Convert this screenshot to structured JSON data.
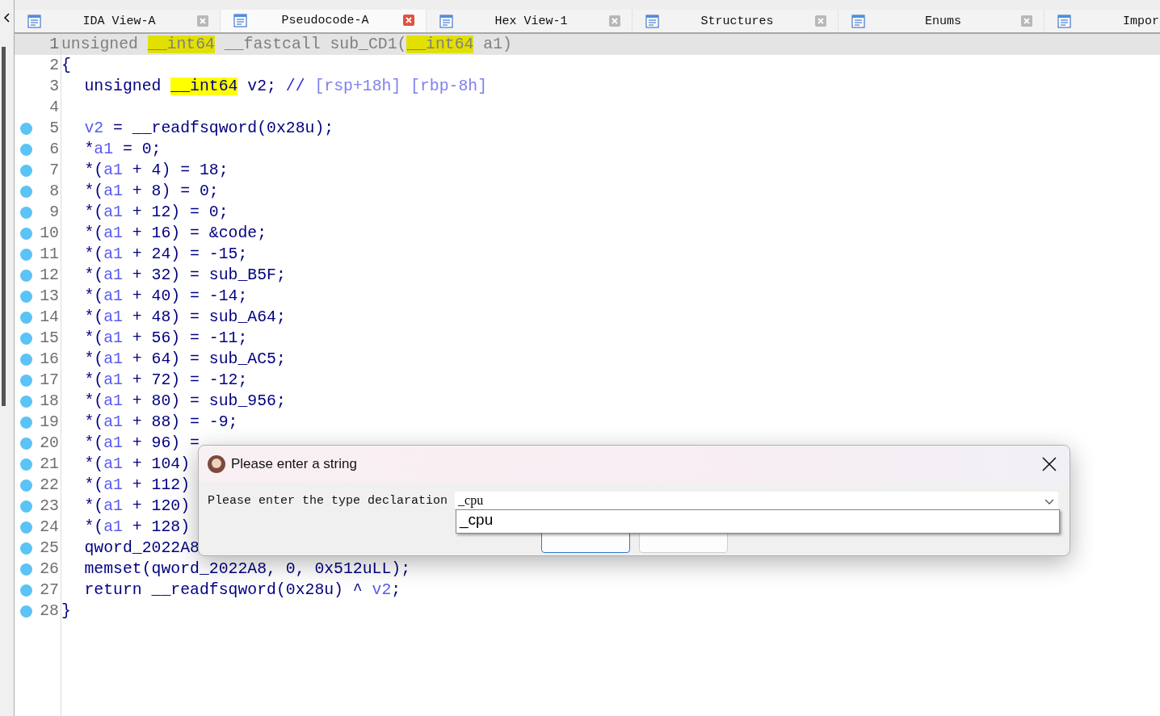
{
  "tabs": [
    {
      "label": "IDA View-A",
      "selected": false
    },
    {
      "label": "Pseudocode-A",
      "selected": true
    },
    {
      "label": "Hex View-1",
      "selected": false
    },
    {
      "label": "Structures",
      "selected": false
    },
    {
      "label": "Enums",
      "selected": false
    },
    {
      "label": "Impor",
      "selected": false
    }
  ],
  "code": {
    "lines": [
      {
        "number": "1",
        "breakpoint": false,
        "current": true,
        "indented": false,
        "segments": [
          {
            "t": "unsigned ",
            "kind": "code"
          },
          {
            "t": "__int64",
            "kind": "hl"
          },
          {
            "t": " __fastcall sub_CD1(",
            "kind": "code"
          },
          {
            "t": "__int64",
            "kind": "hl"
          },
          {
            "t": " a1)",
            "kind": "code"
          }
        ]
      },
      {
        "number": "2",
        "breakpoint": false,
        "current": false,
        "indented": false,
        "segments": [
          {
            "t": "{",
            "kind": "code"
          }
        ]
      },
      {
        "number": "3",
        "breakpoint": false,
        "current": false,
        "indented": true,
        "segments": [
          {
            "t": "unsigned ",
            "kind": "code"
          },
          {
            "t": "__int64",
            "kind": "hl"
          },
          {
            "t": " v2; ",
            "kind": "code"
          },
          {
            "t": "//",
            "kind": "comment"
          },
          {
            "t": " [rsp+18h] [rbp-8h]",
            "kind": "note"
          }
        ]
      },
      {
        "number": "4",
        "breakpoint": false,
        "current": false
      },
      {
        "number": "5",
        "breakpoint": true,
        "current": false,
        "indented": true,
        "segments": [
          {
            "t": "v2",
            "kind": "var"
          },
          {
            "t": " = __readfsqword(0x28u);",
            "kind": "code"
          }
        ]
      },
      {
        "number": "6",
        "breakpoint": true,
        "current": false,
        "indented": true,
        "segments": [
          {
            "t": "*",
            "kind": "code"
          },
          {
            "t": "a1",
            "kind": "var"
          },
          {
            "t": " = 0;",
            "kind": "code"
          }
        ]
      },
      {
        "number": "7",
        "breakpoint": true,
        "current": false,
        "indented": true,
        "segments": [
          {
            "t": "*(",
            "kind": "code"
          },
          {
            "t": "a1",
            "kind": "var"
          },
          {
            "t": " + 4) = 18;",
            "kind": "code"
          }
        ]
      },
      {
        "number": "8",
        "breakpoint": true,
        "current": false,
        "indented": true,
        "segments": [
          {
            "t": "*(",
            "kind": "code"
          },
          {
            "t": "a1",
            "kind": "var"
          },
          {
            "t": " + 8) = 0;",
            "kind": "code"
          }
        ]
      },
      {
        "number": "9",
        "breakpoint": true,
        "current": false,
        "indented": true,
        "segments": [
          {
            "t": "*(",
            "kind": "code"
          },
          {
            "t": "a1",
            "kind": "var"
          },
          {
            "t": " + 12) = 0;",
            "kind": "code"
          }
        ]
      },
      {
        "number": "10",
        "breakpoint": true,
        "current": false,
        "indented": true,
        "segments": [
          {
            "t": "*(",
            "kind": "code"
          },
          {
            "t": "a1",
            "kind": "var"
          },
          {
            "t": " + 16) = &code;",
            "kind": "code"
          }
        ]
      },
      {
        "number": "11",
        "breakpoint": true,
        "current": false,
        "indented": true,
        "segments": [
          {
            "t": "*(",
            "kind": "code"
          },
          {
            "t": "a1",
            "kind": "var"
          },
          {
            "t": " + 24) = -15;",
            "kind": "code"
          }
        ]
      },
      {
        "number": "12",
        "breakpoint": true,
        "current": false,
        "indented": true,
        "segments": [
          {
            "t": "*(",
            "kind": "code"
          },
          {
            "t": "a1",
            "kind": "var"
          },
          {
            "t": " + 32) = sub_B5F;",
            "kind": "code"
          }
        ]
      },
      {
        "number": "13",
        "breakpoint": true,
        "current": false,
        "indented": true,
        "segments": [
          {
            "t": "*(",
            "kind": "code"
          },
          {
            "t": "a1",
            "kind": "var"
          },
          {
            "t": " + 40) = -14;",
            "kind": "code"
          }
        ]
      },
      {
        "number": "14",
        "breakpoint": true,
        "current": false,
        "indented": true,
        "segments": [
          {
            "t": "*(",
            "kind": "code"
          },
          {
            "t": "a1",
            "kind": "var"
          },
          {
            "t": " + 48) = sub_A64;",
            "kind": "code"
          }
        ]
      },
      {
        "number": "15",
        "breakpoint": true,
        "current": false,
        "indented": true,
        "segments": [
          {
            "t": "*(",
            "kind": "code"
          },
          {
            "t": "a1",
            "kind": "var"
          },
          {
            "t": " + 56) = -11;",
            "kind": "code"
          }
        ]
      },
      {
        "number": "16",
        "breakpoint": true,
        "current": false,
        "indented": true,
        "segments": [
          {
            "t": "*(",
            "kind": "code"
          },
          {
            "t": "a1",
            "kind": "var"
          },
          {
            "t": " + 64) = sub_AC5;",
            "kind": "code"
          }
        ]
      },
      {
        "number": "17",
        "breakpoint": true,
        "current": false,
        "indented": true,
        "segments": [
          {
            "t": "*(",
            "kind": "code"
          },
          {
            "t": "a1",
            "kind": "var"
          },
          {
            "t": " + 72) = -12;",
            "kind": "code"
          }
        ]
      },
      {
        "number": "18",
        "breakpoint": true,
        "current": false,
        "indented": true,
        "segments": [
          {
            "t": "*(",
            "kind": "code"
          },
          {
            "t": "a1",
            "kind": "var"
          },
          {
            "t": " + 80) = sub_956;",
            "kind": "code"
          }
        ]
      },
      {
        "number": "19",
        "breakpoint": true,
        "current": false,
        "indented": true,
        "segments": [
          {
            "t": "*(",
            "kind": "code"
          },
          {
            "t": "a1",
            "kind": "var"
          },
          {
            "t": " + 88) = -9;",
            "kind": "code"
          }
        ]
      },
      {
        "number": "20",
        "breakpoint": true,
        "current": false,
        "indented": true,
        "segments": [
          {
            "t": "*(",
            "kind": "code"
          },
          {
            "t": "a1",
            "kind": "var"
          },
          {
            "t": " + 96) =",
            "kind": "code"
          }
        ]
      },
      {
        "number": "21",
        "breakpoint": true,
        "current": false,
        "indented": true,
        "segments": [
          {
            "t": "*(",
            "kind": "code"
          },
          {
            "t": "a1",
            "kind": "var"
          },
          {
            "t": " + 104)",
            "kind": "code"
          }
        ]
      },
      {
        "number": "22",
        "breakpoint": true,
        "current": false,
        "indented": true,
        "segments": [
          {
            "t": "*(",
            "kind": "code"
          },
          {
            "t": "a1",
            "kind": "var"
          },
          {
            "t": " + 112)",
            "kind": "code"
          }
        ]
      },
      {
        "number": "23",
        "breakpoint": true,
        "current": false,
        "indented": true,
        "segments": [
          {
            "t": "*(",
            "kind": "code"
          },
          {
            "t": "a1",
            "kind": "var"
          },
          {
            "t": " + 120)",
            "kind": "code"
          }
        ]
      },
      {
        "number": "24",
        "breakpoint": true,
        "current": false,
        "indented": true,
        "segments": [
          {
            "t": "*(",
            "kind": "code"
          },
          {
            "t": "a1",
            "kind": "var"
          },
          {
            "t": " + 128)",
            "kind": "code"
          }
        ]
      },
      {
        "number": "25",
        "breakpoint": true,
        "current": false,
        "indented": true,
        "segments": [
          {
            "t": "qword_2022A8",
            "kind": "code"
          }
        ]
      },
      {
        "number": "26",
        "breakpoint": true,
        "current": false,
        "indented": true,
        "segments": [
          {
            "t": "memset(qword_2022A8, 0, 0x512uLL);",
            "kind": "code"
          }
        ]
      },
      {
        "number": "27",
        "breakpoint": true,
        "current": false,
        "indented": true,
        "segments": [
          {
            "t": "return __readfsqword(0x28u) ^ ",
            "kind": "code"
          },
          {
            "t": "v2",
            "kind": "var"
          },
          {
            "t": ";",
            "kind": "code"
          }
        ]
      },
      {
        "number": "28",
        "breakpoint": true,
        "current": false,
        "indented": false,
        "segments": [
          {
            "t": "}",
            "kind": "code"
          }
        ]
      }
    ]
  },
  "dialog": {
    "title": "Please enter a string",
    "prompt": "Please enter the type declaration",
    "value": "_cpu",
    "suggestions": [
      "_cpu"
    ]
  }
}
